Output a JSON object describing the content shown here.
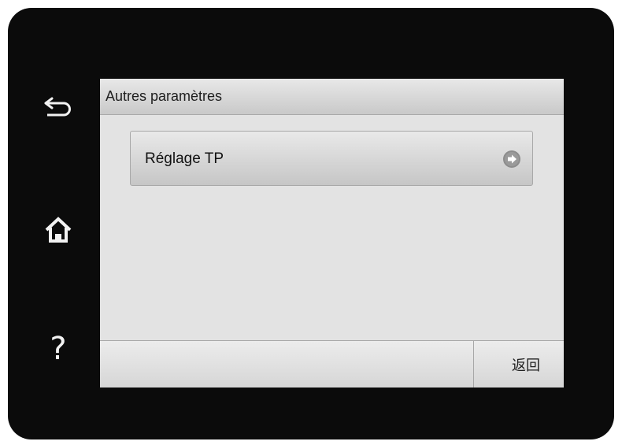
{
  "screen": {
    "title": "Autres paramètres",
    "menu_items": [
      {
        "label": "Réglage TP",
        "icon": "chevron-right-circle-icon"
      }
    ],
    "bottom_bar": {
      "back_label": "返回"
    }
  },
  "hardware_buttons": {
    "back_icon": "back-arrow-icon",
    "home_icon": "home-icon",
    "help_label": "?"
  },
  "colors": {
    "bezel": "#0b0b0b",
    "screen_background": "#e3e3e3",
    "text": "#1e1e1e"
  }
}
